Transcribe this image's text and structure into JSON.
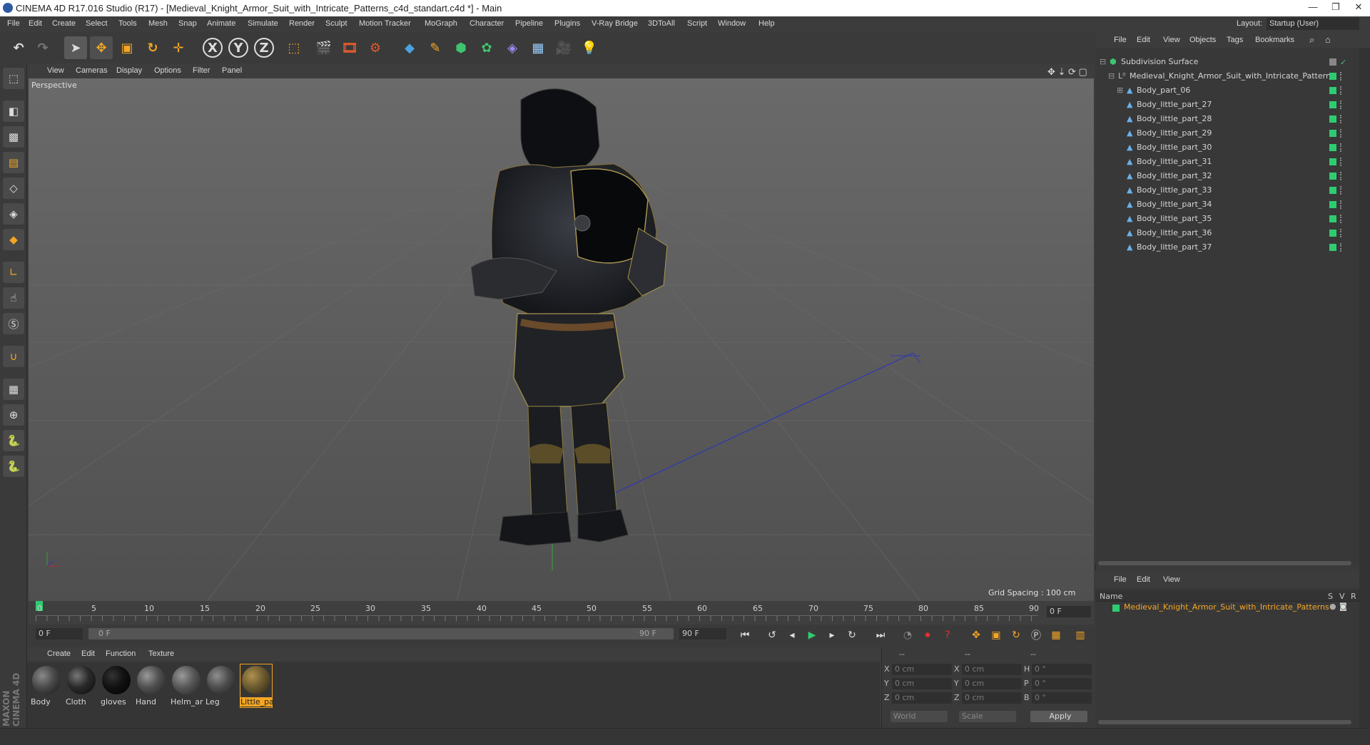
{
  "window": {
    "title": "CINEMA 4D R17.016 Studio (R17) - [Medieval_Knight_Armor_Suit_with_Intricate_Patterns_c4d_standart.c4d *] - Main",
    "min": "—",
    "max": "❐",
    "close": "✕"
  },
  "menu": [
    "File",
    "Edit",
    "Create",
    "Select",
    "Tools",
    "Mesh",
    "Snap",
    "Animate",
    "Simulate",
    "Render",
    "Sculpt",
    "Motion Tracker",
    "MoGraph",
    "Character",
    "Pipeline",
    "Plugins",
    "V-Ray Bridge",
    "3DToAll",
    "Script",
    "Window",
    "Help"
  ],
  "layout": {
    "label": "Layout:",
    "value": "Startup (User)"
  },
  "viewport": {
    "menu": [
      "View",
      "Cameras",
      "Display",
      "Options",
      "Filter",
      "Panel"
    ],
    "camera_label": "Perspective",
    "grid_spacing": "Grid Spacing : 100 cm"
  },
  "timeline": {
    "ticks": [
      "0",
      "5",
      "10",
      "15",
      "20",
      "25",
      "30",
      "35",
      "40",
      "45",
      "50",
      "55",
      "60",
      "65",
      "70",
      "75",
      "80",
      "85",
      "90"
    ],
    "current_frame": "0 F",
    "start_field": "0 F",
    "range_start": "0 F",
    "range_end": "90 F",
    "end_field": "90 F"
  },
  "materials_menu": [
    "Create",
    "Edit",
    "Function",
    "Texture"
  ],
  "materials": [
    {
      "name": "Body",
      "color": "#4a4a4a"
    },
    {
      "name": "Cloth",
      "color": "#2a2a2a"
    },
    {
      "name": "gloves",
      "color": "#111111"
    },
    {
      "name": "Hand",
      "color": "#505050"
    },
    {
      "name": "Helm_ar",
      "color": "#575757"
    },
    {
      "name": "Leg",
      "color": "#4d4d4d"
    },
    {
      "name": "Little_pa",
      "color": "#6b5a30"
    }
  ],
  "coords": {
    "headers": [
      "--",
      "--",
      "--"
    ],
    "rows": [
      {
        "a": "X",
        "av": "0 cm",
        "b": "X",
        "bv": "0 cm",
        "c": "H",
        "cv": "0 °"
      },
      {
        "a": "Y",
        "av": "0 cm",
        "b": "Y",
        "bv": "0 cm",
        "c": "P",
        "cv": "0 °"
      },
      {
        "a": "Z",
        "av": "0 cm",
        "b": "Z",
        "bv": "0 cm",
        "c": "B",
        "cv": "0 °"
      }
    ],
    "world": "World",
    "scale": "Scale",
    "apply": "Apply"
  },
  "object_manager": {
    "menu": [
      "File",
      "Edit",
      "View",
      "Objects",
      "Tags",
      "Bookmarks"
    ],
    "root": "Subdivision Surface",
    "group": "Medieval_Knight_Armor_Suit_with_Intricate_Patterns",
    "items": [
      "Body_part_06",
      "Body_little_part_27",
      "Body_little_part_28",
      "Body_little_part_29",
      "Body_little_part_30",
      "Body_little_part_31",
      "Body_little_part_32",
      "Body_little_part_33",
      "Body_little_part_34",
      "Body_little_part_35",
      "Body_little_part_36",
      "Body_little_part_37"
    ]
  },
  "attributes": {
    "menu": [
      "File",
      "Edit",
      "View"
    ],
    "headers": {
      "name": "Name",
      "s": "S",
      "v": "V",
      "r": "R"
    },
    "item": "Medieval_Knight_Armor_Suit_with_Intricate_Patterns"
  },
  "brand": "MAXON CINEMA 4D"
}
